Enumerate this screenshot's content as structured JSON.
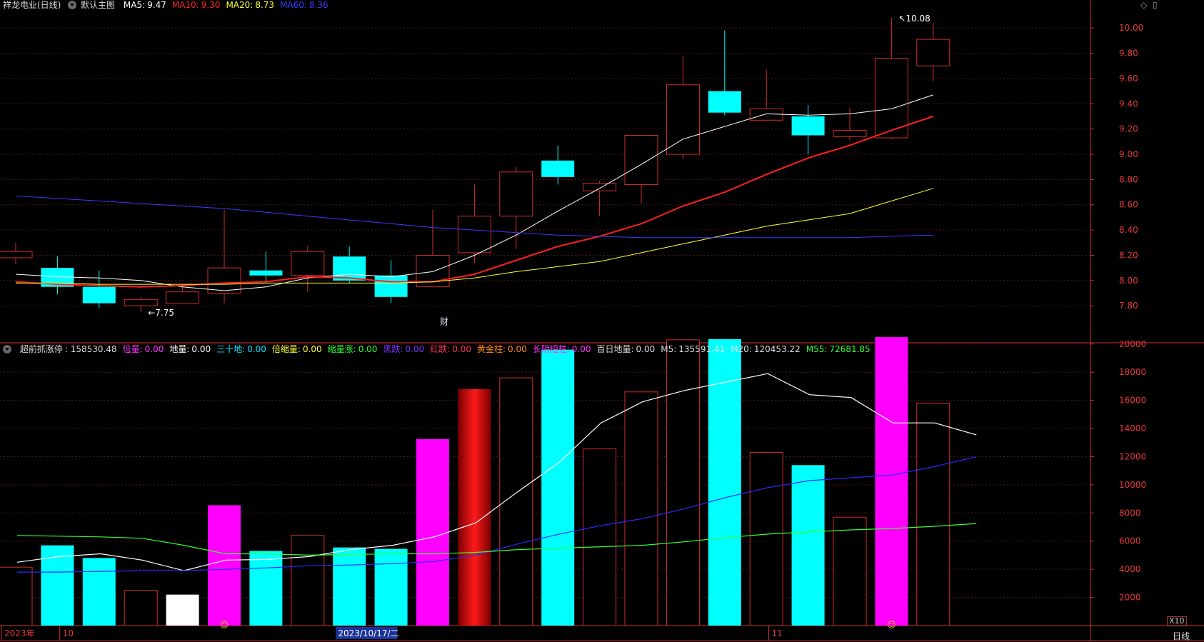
{
  "stock": {
    "title": "祥龙电业(日线)",
    "template": "默认主图"
  },
  "main_legend": [
    {
      "label": "MA5:",
      "value": "9.47",
      "color": "#ffffff"
    },
    {
      "label": "MA10:",
      "value": "9.30",
      "color": "#ff2020"
    },
    {
      "label": "MA20:",
      "value": "8.73",
      "color": "#ffff33"
    },
    {
      "label": "MA60:",
      "value": "8.36",
      "color": "#3b3bff"
    }
  ],
  "sub_legend": [
    {
      "label": "超前抓涨停",
      "value": ": 158530.48",
      "color": "#dcdcdc"
    },
    {
      "label": "倍量:",
      "value": "0.00",
      "color": "#ff33ff"
    },
    {
      "label": "地量:",
      "value": "0.00",
      "color": "#ffffff"
    },
    {
      "label": "三十地:",
      "value": "0.00",
      "color": "#00e5ff"
    },
    {
      "label": "倍缩量:",
      "value": "0.00",
      "color": "#ffff33"
    },
    {
      "label": "缩量涨:",
      "value": "0.00",
      "color": "#33ff33"
    },
    {
      "label": "黑跌:",
      "value": "0.00",
      "color": "#7a33ff"
    },
    {
      "label": "红跌:",
      "value": "0.00",
      "color": "#ff3355"
    },
    {
      "label": "黄金柱:",
      "value": "0.00",
      "color": "#ff8c1a"
    },
    {
      "label": "长阴短柱:",
      "value": "0.00",
      "color": "#ff33ff"
    },
    {
      "label": "百日地量:",
      "value": "0.00",
      "color": "#dcdcdc"
    },
    {
      "label": "M5:",
      "value": "135591.41",
      "color": "#dcdcdc"
    },
    {
      "label": "M20:",
      "value": "120453.22",
      "color": "#dcdcdc"
    },
    {
      "label": "M55:",
      "value": "72681.85",
      "color": "#33ff33"
    }
  ],
  "controls": {
    "diamond": "◇",
    "square": "▯",
    "scale_label": "X10",
    "period_label": "日线"
  },
  "chart_data": [
    {
      "type": "candlestick",
      "ylim": [
        7.62,
        10.12
      ],
      "y_ticks": [
        7.8,
        8.0,
        8.2,
        8.4,
        8.6,
        8.8,
        9.0,
        9.2,
        9.4,
        9.6,
        9.8,
        10.0
      ],
      "candles": [
        {
          "o": 8.18,
          "c": 8.23,
          "h": 8.3,
          "l": 8.13,
          "kind": "up"
        },
        {
          "o": 8.1,
          "c": 7.95,
          "h": 8.19,
          "l": 7.89,
          "kind": "down"
        },
        {
          "o": 7.95,
          "c": 7.82,
          "h": 8.08,
          "l": 7.78,
          "kind": "down"
        },
        {
          "o": 7.8,
          "c": 7.85,
          "h": 7.87,
          "l": 7.75,
          "kind": "up"
        },
        {
          "o": 7.82,
          "c": 7.91,
          "h": 7.97,
          "l": 7.82,
          "kind": "up"
        },
        {
          "o": 7.9,
          "c": 8.1,
          "h": 8.56,
          "l": 7.82,
          "kind": "up"
        },
        {
          "o": 8.08,
          "c": 8.04,
          "h": 8.23,
          "l": 7.99,
          "kind": "down"
        },
        {
          "o": 8.04,
          "c": 8.23,
          "h": 8.27,
          "l": 7.91,
          "kind": "up"
        },
        {
          "o": 8.19,
          "c": 8.0,
          "h": 8.27,
          "l": 7.98,
          "kind": "down"
        },
        {
          "o": 8.04,
          "c": 7.87,
          "h": 8.16,
          "l": 7.82,
          "kind": "down"
        },
        {
          "o": 7.95,
          "c": 8.2,
          "h": 8.56,
          "l": 7.95,
          "kind": "up"
        },
        {
          "o": 8.22,
          "c": 8.51,
          "h": 8.76,
          "l": 8.14,
          "kind": "up"
        },
        {
          "o": 8.51,
          "c": 8.86,
          "h": 8.9,
          "l": 8.25,
          "kind": "up"
        },
        {
          "o": 8.95,
          "c": 8.82,
          "h": 9.07,
          "l": 8.76,
          "kind": "down"
        },
        {
          "o": 8.71,
          "c": 8.77,
          "h": 8.79,
          "l": 8.51,
          "kind": "up"
        },
        {
          "o": 8.76,
          "c": 9.15,
          "h": 9.15,
          "l": 8.61,
          "kind": "up"
        },
        {
          "o": 9.0,
          "c": 9.55,
          "h": 9.78,
          "l": 8.96,
          "kind": "up"
        },
        {
          "o": 9.5,
          "c": 9.33,
          "h": 9.98,
          "l": 9.31,
          "kind": "down"
        },
        {
          "o": 9.27,
          "c": 9.36,
          "h": 9.67,
          "l": 9.27,
          "kind": "up"
        },
        {
          "o": 9.3,
          "c": 9.15,
          "h": 9.39,
          "l": 9.0,
          "kind": "down"
        },
        {
          "o": 9.14,
          "c": 9.19,
          "h": 9.37,
          "l": 9.11,
          "kind": "up"
        },
        {
          "o": 9.13,
          "c": 9.76,
          "h": 10.08,
          "l": 9.12,
          "kind": "up"
        },
        {
          "o": 9.7,
          "c": 9.91,
          "h": 10.04,
          "l": 9.58,
          "kind": "up"
        }
      ],
      "ma_lines": [
        {
          "name": "MA5",
          "color": "#ffffff",
          "width": 1,
          "start": 0,
          "values": [
            8.05,
            8.03,
            8.02,
            8.0,
            7.95,
            7.92,
            7.95,
            8.02,
            8.05,
            8.03,
            8.07,
            8.2,
            8.36,
            8.55,
            8.73,
            8.92,
            9.12,
            9.22,
            9.32,
            9.31,
            9.32,
            9.36,
            9.47
          ]
        },
        {
          "name": "MA10",
          "color": "#ff2020",
          "width": 2,
          "start": 0,
          "values": [
            7.99,
            7.97,
            7.96,
            7.95,
            7.96,
            7.98,
            7.99,
            8.03,
            8.02,
            7.99,
            7.99,
            8.05,
            8.16,
            8.27,
            8.35,
            8.45,
            8.59,
            8.7,
            8.84,
            8.97,
            9.07,
            9.19,
            9.3
          ]
        },
        {
          "name": "MA20",
          "color": "#ffff33",
          "width": 1,
          "start": 0,
          "values": [
            7.98,
            7.98,
            7.97,
            7.97,
            7.97,
            7.97,
            7.98,
            7.98,
            7.98,
            7.98,
            7.99,
            8.02,
            8.07,
            8.11,
            8.15,
            8.22,
            8.29,
            8.36,
            8.43,
            8.48,
            8.53,
            8.63,
            8.73
          ]
        },
        {
          "name": "MA60",
          "color": "#3b3bff",
          "width": 1,
          "start": 0,
          "values": [
            8.67,
            8.65,
            8.63,
            8.61,
            8.59,
            8.57,
            8.54,
            8.51,
            8.48,
            8.45,
            8.42,
            8.4,
            8.38,
            8.36,
            8.35,
            8.34,
            8.34,
            8.34,
            8.34,
            8.34,
            8.34,
            8.35,
            8.36
          ]
        }
      ],
      "annotations": [
        {
          "text": "10.08",
          "at": 21,
          "value": 10.08,
          "arrow": "↖"
        },
        {
          "text": "←7.75",
          "at": 3,
          "value": 7.75,
          "arrow": ""
        },
        {
          "text": "财",
          "at": 10,
          "value": 7.68,
          "arrow": ""
        }
      ]
    },
    {
      "type": "bar",
      "ylim": [
        0,
        20800
      ],
      "y_ticks": [
        2000,
        4000,
        6000,
        8000,
        10000,
        12000,
        14000,
        16000,
        18000,
        20000
      ],
      "bars": [
        {
          "v": 4150,
          "style": "outline"
        },
        {
          "v": 5700,
          "style": "cyan"
        },
        {
          "v": 4800,
          "style": "cyan"
        },
        {
          "v": 2500,
          "style": "outline"
        },
        {
          "v": 2200,
          "style": "white"
        },
        {
          "v": 8550,
          "style": "magenta"
        },
        {
          "v": 5300,
          "style": "cyan"
        },
        {
          "v": 6400,
          "style": "outline"
        },
        {
          "v": 5550,
          "style": "cyan"
        },
        {
          "v": 5450,
          "style": "cyan"
        },
        {
          "v": 13250,
          "style": "magenta"
        },
        {
          "v": 16800,
          "style": "red-gradient"
        },
        {
          "v": 17600,
          "style": "outline"
        },
        {
          "v": 19600,
          "style": "cyan"
        },
        {
          "v": 12550,
          "style": "outline"
        },
        {
          "v": 16600,
          "style": "outline"
        },
        {
          "v": 20300,
          "style": "outline"
        },
        {
          "v": 20350,
          "style": "cyan"
        },
        {
          "v": 12300,
          "style": "outline"
        },
        {
          "v": 11400,
          "style": "cyan"
        },
        {
          "v": 7700,
          "style": "outline"
        },
        {
          "v": 20500,
          "style": "magenta"
        },
        {
          "v": 15800,
          "style": "outline"
        }
      ],
      "lines": [
        {
          "name": "M5",
          "color": "#ffffff",
          "start": 0,
          "values": [
            4500,
            4900,
            5100,
            4650,
            3900,
            4650,
            4700,
            4900,
            5400,
            5700,
            6300,
            7300,
            9500,
            11600,
            14400,
            15900,
            16700,
            17300,
            17900,
            16400,
            16200,
            14400,
            14400,
            13550
          ]
        },
        {
          "name": "M20",
          "color": "#2a2aff",
          "start": 0,
          "values": [
            3800,
            3800,
            3850,
            3900,
            3900,
            4000,
            4100,
            4250,
            4300,
            4400,
            4550,
            5000,
            5800,
            6500,
            7100,
            7600,
            8300,
            9100,
            9800,
            10300,
            10500,
            10700,
            11300,
            12000
          ]
        },
        {
          "name": "M55",
          "color": "#33ff33",
          "start": 0,
          "values": [
            6400,
            6350,
            6300,
            6200,
            5700,
            5100,
            5100,
            5000,
            5050,
            5100,
            5100,
            5200,
            5400,
            5500,
            5600,
            5700,
            5950,
            6250,
            6500,
            6650,
            6800,
            6900,
            7050,
            7250
          ]
        }
      ],
      "markers": [
        {
          "at": 5,
          "glyph": "☺"
        },
        {
          "at": 21,
          "glyph": "☺"
        }
      ]
    }
  ],
  "time_axis": {
    "labels": [
      {
        "text": "2023年",
        "at": 0,
        "highlight": false
      },
      {
        "text": "10",
        "at": 1.4,
        "highlight": false
      },
      {
        "text": "2023/10/17/二",
        "at": 7.3,
        "highlight": true
      },
      {
        "text": "11",
        "at": 18.4,
        "highlight": false
      }
    ]
  }
}
